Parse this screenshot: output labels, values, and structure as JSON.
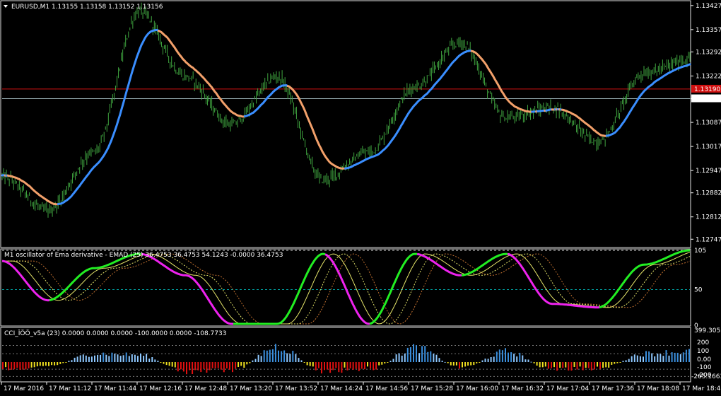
{
  "main": {
    "symbol_line": "EURUSD,M1  1.13155 1.13158 1.13152 1.13156",
    "price_ticks": [
      "1.13427",
      "1.13357",
      "1.13292",
      "1.13222",
      "1.13156",
      "1.13087",
      "1.13017",
      "1.12947",
      "1.12882",
      "1.12812",
      "1.12747"
    ],
    "tick_values": [
      1.13427,
      1.13357,
      1.13292,
      1.13222,
      1.13156,
      1.13087,
      1.13017,
      1.12947,
      1.12882,
      1.12812,
      1.12747
    ],
    "current_price_label": "1.13156",
    "red_line_label": "1.13190",
    "red_line_value": 1.13184,
    "colors": {
      "bars": "#3fa33f",
      "ma_up": "#3a8eff",
      "ma_down": "#f2a06a",
      "price_line": "#9ab0b6",
      "red_line": "#d01010"
    }
  },
  "oscillator": {
    "title": "M1 oscillator of Ema derivative - EMAD (25) 36.4753 36.4753 54.1243 -0.0000 36.4753",
    "ticks": [
      "105",
      "50",
      "0"
    ],
    "tick_values": [
      105,
      50,
      0
    ],
    "colors": {
      "up": "#22ee22",
      "down": "#ee22ee",
      "yellow": "#e6e66a",
      "level": "#00a0a0"
    }
  },
  "cci": {
    "title": "CCI_ÎÖÖ_v5a (23) 0.0000 0.0000 0.0000 -100.0000 0.0000 -108.7733",
    "ticks": [
      "399.3055",
      "200",
      "100",
      "0.00",
      "-100",
      "-200",
      "-265.1663"
    ],
    "colors": {
      "blue": "#3a8edc",
      "light_blue": "#8ec8ff",
      "yellow": "#f0e020",
      "red": "#e01010",
      "green": "#22ee22"
    }
  },
  "time_axis": [
    "17 Mar 2016",
    "17 Mar 11:12",
    "17 Mar 11:44",
    "17 Mar 12:16",
    "17 Mar 12:48",
    "17 Mar 13:20",
    "17 Mar 13:52",
    "17 Mar 14:24",
    "17 Mar 14:56",
    "17 Mar 15:28",
    "17 Mar 16:00",
    "17 Mar 16:32",
    "17 Mar 17:04",
    "17 Mar 17:36",
    "17 Mar 18:08",
    "17 Mar 18:40"
  ],
  "chart_data": [
    {
      "type": "line",
      "title": "EURUSD,M1  1.13155 1.13158 1.13152 1.13156",
      "xlabel": "",
      "ylabel": "",
      "ylim": [
        1.12727,
        1.13437
      ],
      "x": [
        "17 Mar 2016",
        "17 Mar 11:12",
        "17 Mar 11:44",
        "17 Mar 12:16",
        "17 Mar 12:48",
        "17 Mar 13:20",
        "17 Mar 13:52",
        "17 Mar 14:24",
        "17 Mar 14:56",
        "17 Mar 15:28",
        "17 Mar 16:00",
        "17 Mar 16:32",
        "17 Mar 17:04",
        "17 Mar 17:36",
        "17 Mar 18:08",
        "17 Mar 18:40"
      ],
      "series": [
        {
          "name": "",
          "values": [
            1.1293,
            1.1283,
            1.13,
            1.1341,
            1.1322,
            1.1308,
            1.1322,
            1.1292,
            1.13,
            1.1319,
            1.1332,
            1.131,
            1.1313,
            1.1303,
            1.1323,
            1.1327
          ]
        }
      ]
    },
    {
      "type": "line",
      "title": "M1 oscillator of Ema derivative - EMAD (25) 36.4753 36.4753 54.1243 -0.0000 36.4753",
      "ylim": [
        0,
        105
      ],
      "x": [
        "17 Mar 2016",
        "17 Mar 11:12",
        "17 Mar 11:44",
        "17 Mar 12:16",
        "17 Mar 12:48",
        "17 Mar 13:20",
        "17 Mar 13:52",
        "17 Mar 14:24",
        "17 Mar 14:56",
        "17 Mar 15:28",
        "17 Mar 16:00",
        "17 Mar 16:32",
        "17 Mar 17:04",
        "17 Mar 17:36",
        "17 Mar 18:08",
        "17 Mar 18:40"
      ],
      "series": [
        {
          "name": "",
          "values": [
            90,
            35,
            80,
            100,
            70,
            2,
            2,
            100,
            2,
            100,
            70,
            100,
            30,
            25,
            85,
            105
          ]
        }
      ]
    },
    {
      "type": "bar",
      "title": "CCI_ÎÖÖ_v5a (23) 0.0000 0.0000 0.0000 -100.0000 0.0000 -108.7733",
      "ylim": [
        -265.1663,
        399.3055
      ],
      "x": [
        "17 Mar 2016",
        "17 Mar 11:12",
        "17 Mar 11:44",
        "17 Mar 12:16",
        "17 Mar 12:48",
        "17 Mar 13:20",
        "17 Mar 13:52",
        "17 Mar 14:24",
        "17 Mar 14:56",
        "17 Mar 15:28",
        "17 Mar 16:00",
        "17 Mar 16:32",
        "17 Mar 17:04",
        "17 Mar 17:36",
        "17 Mar 18:08",
        "17 Mar 18:40"
      ],
      "series": [
        {
          "name": "",
          "values": [
            -120,
            -60,
            120,
            100,
            -150,
            -130,
            220,
            -150,
            -110,
            200,
            -80,
            150,
            -120,
            -100,
            120,
            150
          ]
        }
      ]
    }
  ]
}
